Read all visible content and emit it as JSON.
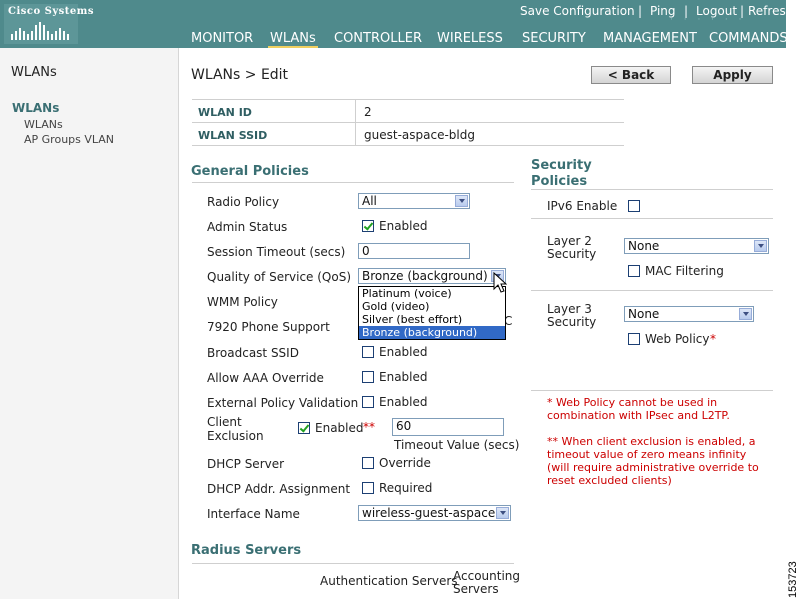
{
  "header": {
    "logo_text": "Cisco Systems",
    "top_links": [
      "Save Configuration",
      "Ping",
      "Logout",
      "Refresh"
    ],
    "nav": [
      "MONITOR",
      "WLANs",
      "CONTROLLER",
      "WIRELESS",
      "SECURITY",
      "MANAGEMENT",
      "COMMANDS"
    ],
    "active_nav": "WLANs"
  },
  "sidebar": {
    "title": "WLANs",
    "heading": "WLANs",
    "items": [
      "WLANs",
      "AP Groups VLAN"
    ]
  },
  "main": {
    "title": "WLANs > Edit",
    "back_label": "< Back",
    "apply_label": "Apply",
    "wlan_id_label": "WLAN ID",
    "wlan_id_value": "2",
    "wlan_ssid_label": "WLAN SSID",
    "wlan_ssid_value": "guest-aspace-bldg",
    "general_title": "General Policies",
    "general": {
      "radio_policy_label": "Radio Policy",
      "radio_policy_value": "All",
      "admin_status_label": "Admin Status",
      "admin_status_cb": "Enabled",
      "session_timeout_label": "Session Timeout (secs)",
      "session_timeout_value": "0",
      "qos_label": "Quality of Service (QoS)",
      "qos_value": "Bronze (background)",
      "qos_options": [
        "Platinum (voice)",
        "Gold (video)",
        "Silver (best effort)",
        "Bronze (background)"
      ],
      "wmm_label": "WMM Policy",
      "phone_label": "7920 Phone Support",
      "phone_partial": "C",
      "broadcast_label": "Broadcast SSID",
      "broadcast_cb": "Enabled",
      "aaa_label": "Allow AAA Override",
      "aaa_cb": "Enabled",
      "ext_policy_label": "External Policy Validation",
      "ext_policy_cb": "Enabled",
      "client_excl_label_1": "Client",
      "client_excl_label_2": "Exclusion",
      "client_excl_cb": "Enabled",
      "client_excl_marker": "**",
      "client_excl_timeout": "60",
      "timeout_caption": "Timeout Value (secs)",
      "dhcp_server_label": "DHCP Server",
      "dhcp_server_cb": "Override",
      "dhcp_assign_label": "DHCP Addr. Assignment",
      "dhcp_assign_cb": "Required",
      "interface_label": "Interface Name",
      "interface_value": "wireless-guest-aspace"
    },
    "radius_title": "Radius Servers",
    "radius_auth": "Authentication Servers",
    "radius_acct_1": "Accounting",
    "radius_acct_2": "Servers",
    "security_title_1": "Security",
    "security_title_2": "Policies",
    "security": {
      "ipv6_label": "IPv6 Enable",
      "layer2_label_1": "Layer 2",
      "layer2_label_2": "Security",
      "layer2_value": "None",
      "mac_filter_cb": "MAC Filtering",
      "layer3_label_1": "Layer 3",
      "layer3_label_2": "Security",
      "layer3_value": "None",
      "web_policy_cb": "Web Policy",
      "web_policy_marker": "*"
    },
    "notes": {
      "note1": "* Web Policy cannot be used in combination with IPsec and L2TP.",
      "note2": "** When client exclusion is enabled, a timeout value of zero means infinity (will require administrative override to reset excluded clients)"
    }
  },
  "figure_id": "153723",
  "colors": {
    "header": "#4f8a8c",
    "accent": "#3a6f73",
    "required": "#cc0000",
    "selected": "#3169c6"
  }
}
